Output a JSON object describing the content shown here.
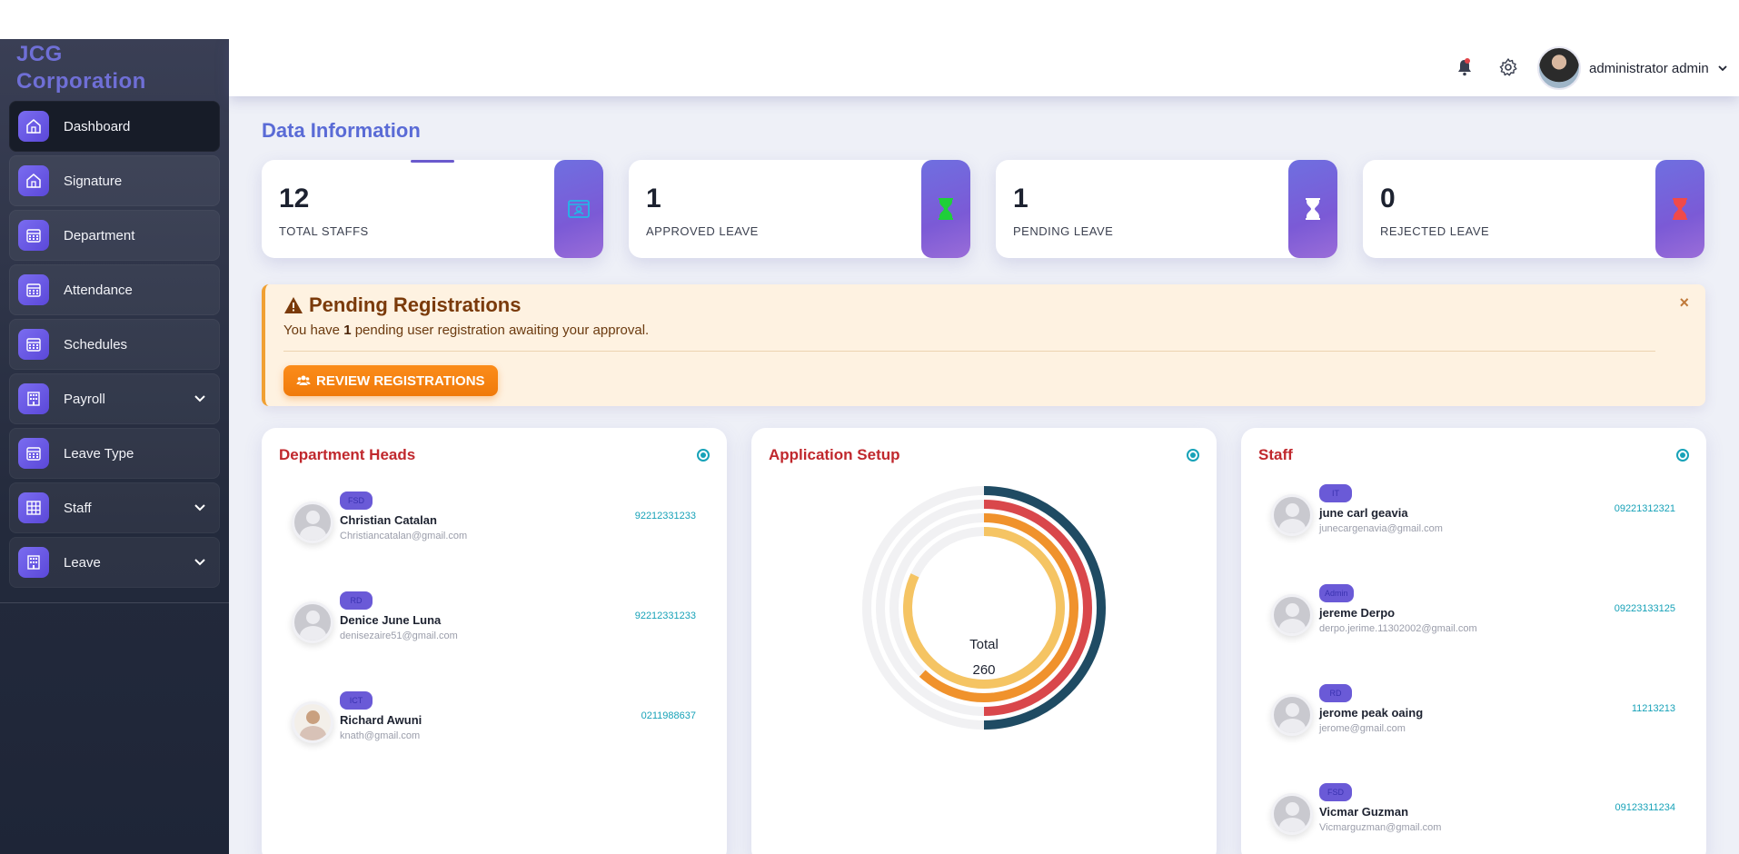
{
  "brand": {
    "line1": "JCG",
    "line2": "Corporation"
  },
  "sidebar": {
    "items": [
      {
        "label": "Dashboard",
        "icon": "home-icon",
        "active": true
      },
      {
        "label": "Signature",
        "icon": "home-icon"
      },
      {
        "label": "Department",
        "icon": "calendar-icon"
      },
      {
        "label": "Attendance",
        "icon": "calendar-icon"
      },
      {
        "label": "Schedules",
        "icon": "calendar-icon"
      },
      {
        "label": "Payroll",
        "icon": "building-icon",
        "expandable": true
      },
      {
        "label": "Leave Type",
        "icon": "calendar-icon"
      },
      {
        "label": "Staff",
        "icon": "table-icon",
        "expandable": true
      },
      {
        "label": "Leave",
        "icon": "building-icon",
        "expandable": true
      }
    ]
  },
  "header": {
    "user_name": "administrator admin",
    "icons": [
      "bell-icon",
      "gear-icon",
      "chevron-down-icon"
    ]
  },
  "page": {
    "title": "Data Information"
  },
  "stats": [
    {
      "value": "12",
      "label": "TOTAL STAFFS",
      "icon": "id-card-icon",
      "icon_color": "#22b8e8"
    },
    {
      "value": "1",
      "label": "APPROVED LEAVE",
      "icon": "hourglass-icon",
      "icon_color": "#1fcf3a"
    },
    {
      "value": "1",
      "label": "PENDING LEAVE",
      "icon": "hourglass-icon",
      "icon_color": "#ffffff"
    },
    {
      "value": "0",
      "label": "REJECTED LEAVE",
      "icon": "hourglass-icon",
      "icon_color": "#f04a4a"
    }
  ],
  "alert": {
    "title": "Pending Registrations",
    "msg_prefix": "You have ",
    "msg_count": "1",
    "msg_suffix": " pending user registration awaiting your approval.",
    "button": "REVIEW REGISTRATIONS",
    "close": "×"
  },
  "panels": {
    "dept_heads": {
      "title": "Department Heads",
      "people": [
        {
          "badge": "FSD",
          "name": "Christian Catalan",
          "email": "Christiancatalan@gmail.com",
          "phone": "92212331233",
          "photo": false
        },
        {
          "badge": "RD",
          "name": "Denice June Luna",
          "email": "denisezaire51@gmail.com",
          "phone": "92212331233",
          "photo": false
        },
        {
          "badge": "ICT",
          "name": "Richard Awuni",
          "email": "knath@gmail.com",
          "phone": "0211988637",
          "photo": true
        }
      ]
    },
    "app_setup": {
      "title": "Application Setup",
      "total_label": "Total",
      "total_value": "260"
    },
    "staff": {
      "title": "Staff",
      "people": [
        {
          "badge": "IT",
          "name": "june carl geavia",
          "email": "junecargenavia@gmail.com",
          "phone": "09221312321",
          "photo": false
        },
        {
          "badge": "Admin",
          "name": "jereme Derpo",
          "email": "derpo.jerime.11302002@gmail.com",
          "phone": "09223133125",
          "photo": false
        },
        {
          "badge": "RD",
          "name": "jerome peak oaing",
          "email": "jerome@gmail.com",
          "phone": "11213213",
          "photo": false
        },
        {
          "badge": "FSD",
          "name": "Vicmar Guzman",
          "email": "Vicmarguzman@gmail.com",
          "phone": "09123311234",
          "photo": false
        }
      ]
    }
  },
  "chart_data": {
    "type": "radialBar",
    "series": [
      {
        "fraction": 0.5,
        "color": "#1f4b63"
      },
      {
        "fraction": 0.5,
        "color": "#d9474b"
      },
      {
        "fraction": 0.62,
        "color": "#f0922c"
      },
      {
        "fraction": 0.82,
        "color": "#f5c463"
      }
    ],
    "track_color": "#f1f1f3",
    "center_label": "Total",
    "center_value": "260"
  }
}
